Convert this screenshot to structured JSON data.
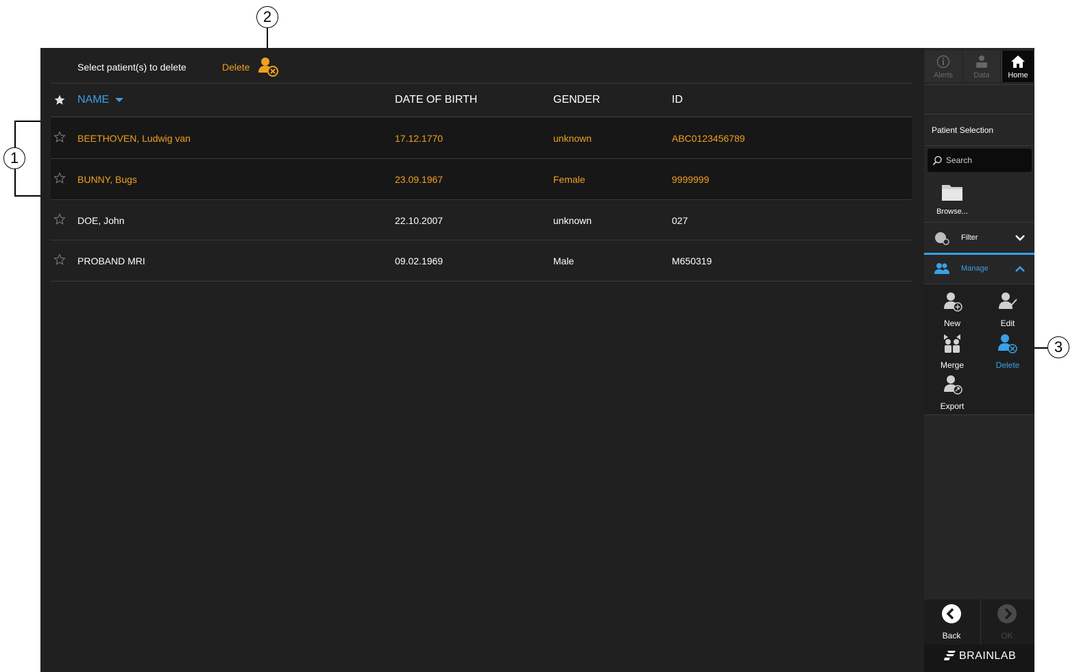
{
  "toolbar": {
    "instruction": "Select patient(s) to delete",
    "delete_label": "Delete"
  },
  "table": {
    "headers": {
      "name": "NAME",
      "dob": "DATE OF BIRTH",
      "gender": "GENDER",
      "id": "ID"
    },
    "rows": [
      {
        "name": "BEETHOVEN, Ludwig van",
        "dob": "17.12.1770",
        "gender": "unknown",
        "id": "ABC0123456789",
        "selected": true
      },
      {
        "name": "BUNNY, Bugs",
        "dob": "23.09.1967",
        "gender": "Female",
        "id": "9999999",
        "selected": true
      },
      {
        "name": "DOE, John",
        "dob": "22.10.2007",
        "gender": "unknown",
        "id": "027",
        "selected": false
      },
      {
        "name": "PROBAND MRI",
        "dob": "09.02.1969",
        "gender": "Male",
        "id": "M650319",
        "selected": false
      }
    ]
  },
  "panel": {
    "tabs": {
      "alerts": "Alerts",
      "data": "Data",
      "home": "Home"
    },
    "section_title": "Patient Selection",
    "search_placeholder": "Search",
    "browse": "Browse...",
    "filter": "Filter",
    "manage": "Manage",
    "actions": {
      "new": "New",
      "edit": "Edit",
      "merge": "Merge",
      "delete": "Delete",
      "export": "Export"
    },
    "back": "Back",
    "ok": "OK",
    "brand": "BRAINLAB"
  },
  "callouts": {
    "c1": "1",
    "c2": "2",
    "c3": "3"
  },
  "colors": {
    "accent_orange": "#f0a020",
    "accent_blue": "#3aa0e8",
    "background": "#202020"
  }
}
